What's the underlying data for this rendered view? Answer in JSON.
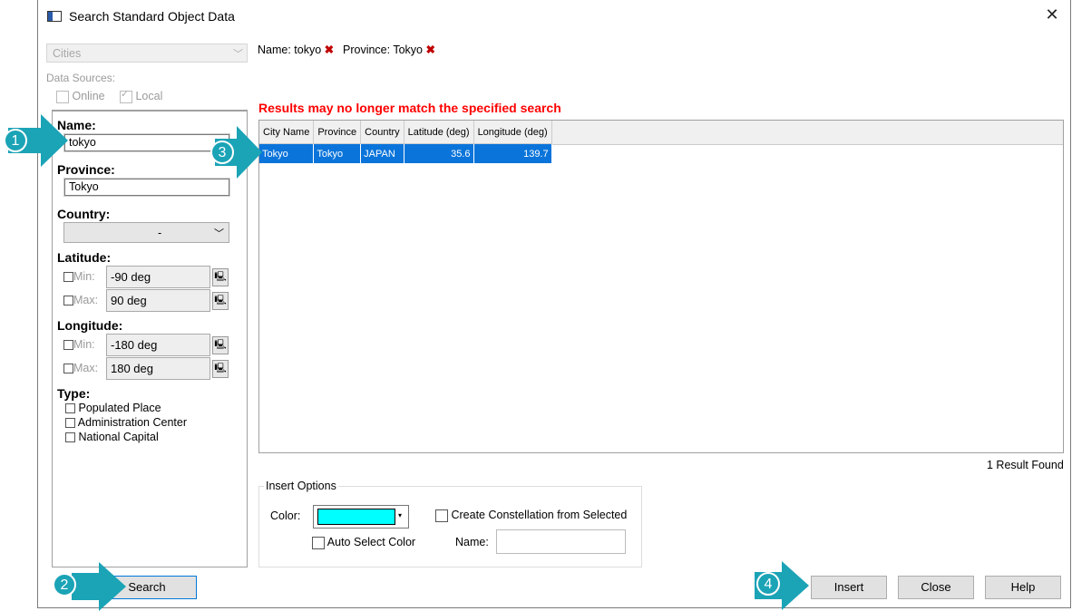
{
  "window": {
    "title": "Search Standard Object Data"
  },
  "object_type": {
    "selected": "Cities"
  },
  "data_sources": {
    "label": "Data Sources:",
    "online": "Online",
    "local": "Local"
  },
  "criteria": [
    {
      "name_label": "Name:",
      "name_value": "tokyo"
    },
    {
      "province_label": "Province:",
      "province_value": "Tokyo"
    }
  ],
  "filters": {
    "country_label": "Country:",
    "country_value": "-",
    "latitude_label": "Latitude:",
    "lat_min_label": "Min:",
    "lat_min": "-90 deg",
    "lat_max_label": "Max:",
    "lat_max": "90 deg",
    "longitude_label": "Longitude:",
    "lon_min_label": "Min:",
    "lon_min": "-180 deg",
    "lon_max_label": "Max:",
    "lon_max": "180 deg",
    "type_label": "Type:",
    "types": [
      "Populated Place",
      "Administration Center",
      "National Capital"
    ]
  },
  "search_button": "Search",
  "active_filters": {
    "name": "Name: tokyo",
    "province": "Province: Tokyo"
  },
  "warning": "Results may no longer match the specified search",
  "results": {
    "columns": [
      "City Name",
      "Province",
      "Country",
      "Latitude (deg)",
      "Longitude (deg)"
    ],
    "rows": [
      [
        "Tokyo",
        "Tokyo",
        "JAPAN",
        "35.6",
        "139.7"
      ]
    ],
    "count_text": "1 Result Found"
  },
  "insert_options": {
    "legend": "Insert Options",
    "color_label": "Color:",
    "color_value": "#00ffff",
    "auto_select": "Auto Select Color",
    "constellation": "Create Constellation from Selected",
    "name_label": "Name:"
  },
  "buttons": {
    "insert": "Insert",
    "close": "Close",
    "help": "Help"
  },
  "markers": [
    "1",
    "2",
    "3",
    "4"
  ],
  "colors": {
    "accent": "#1ba3b6",
    "selection": "#0a74da",
    "warning": "#ff0000"
  }
}
